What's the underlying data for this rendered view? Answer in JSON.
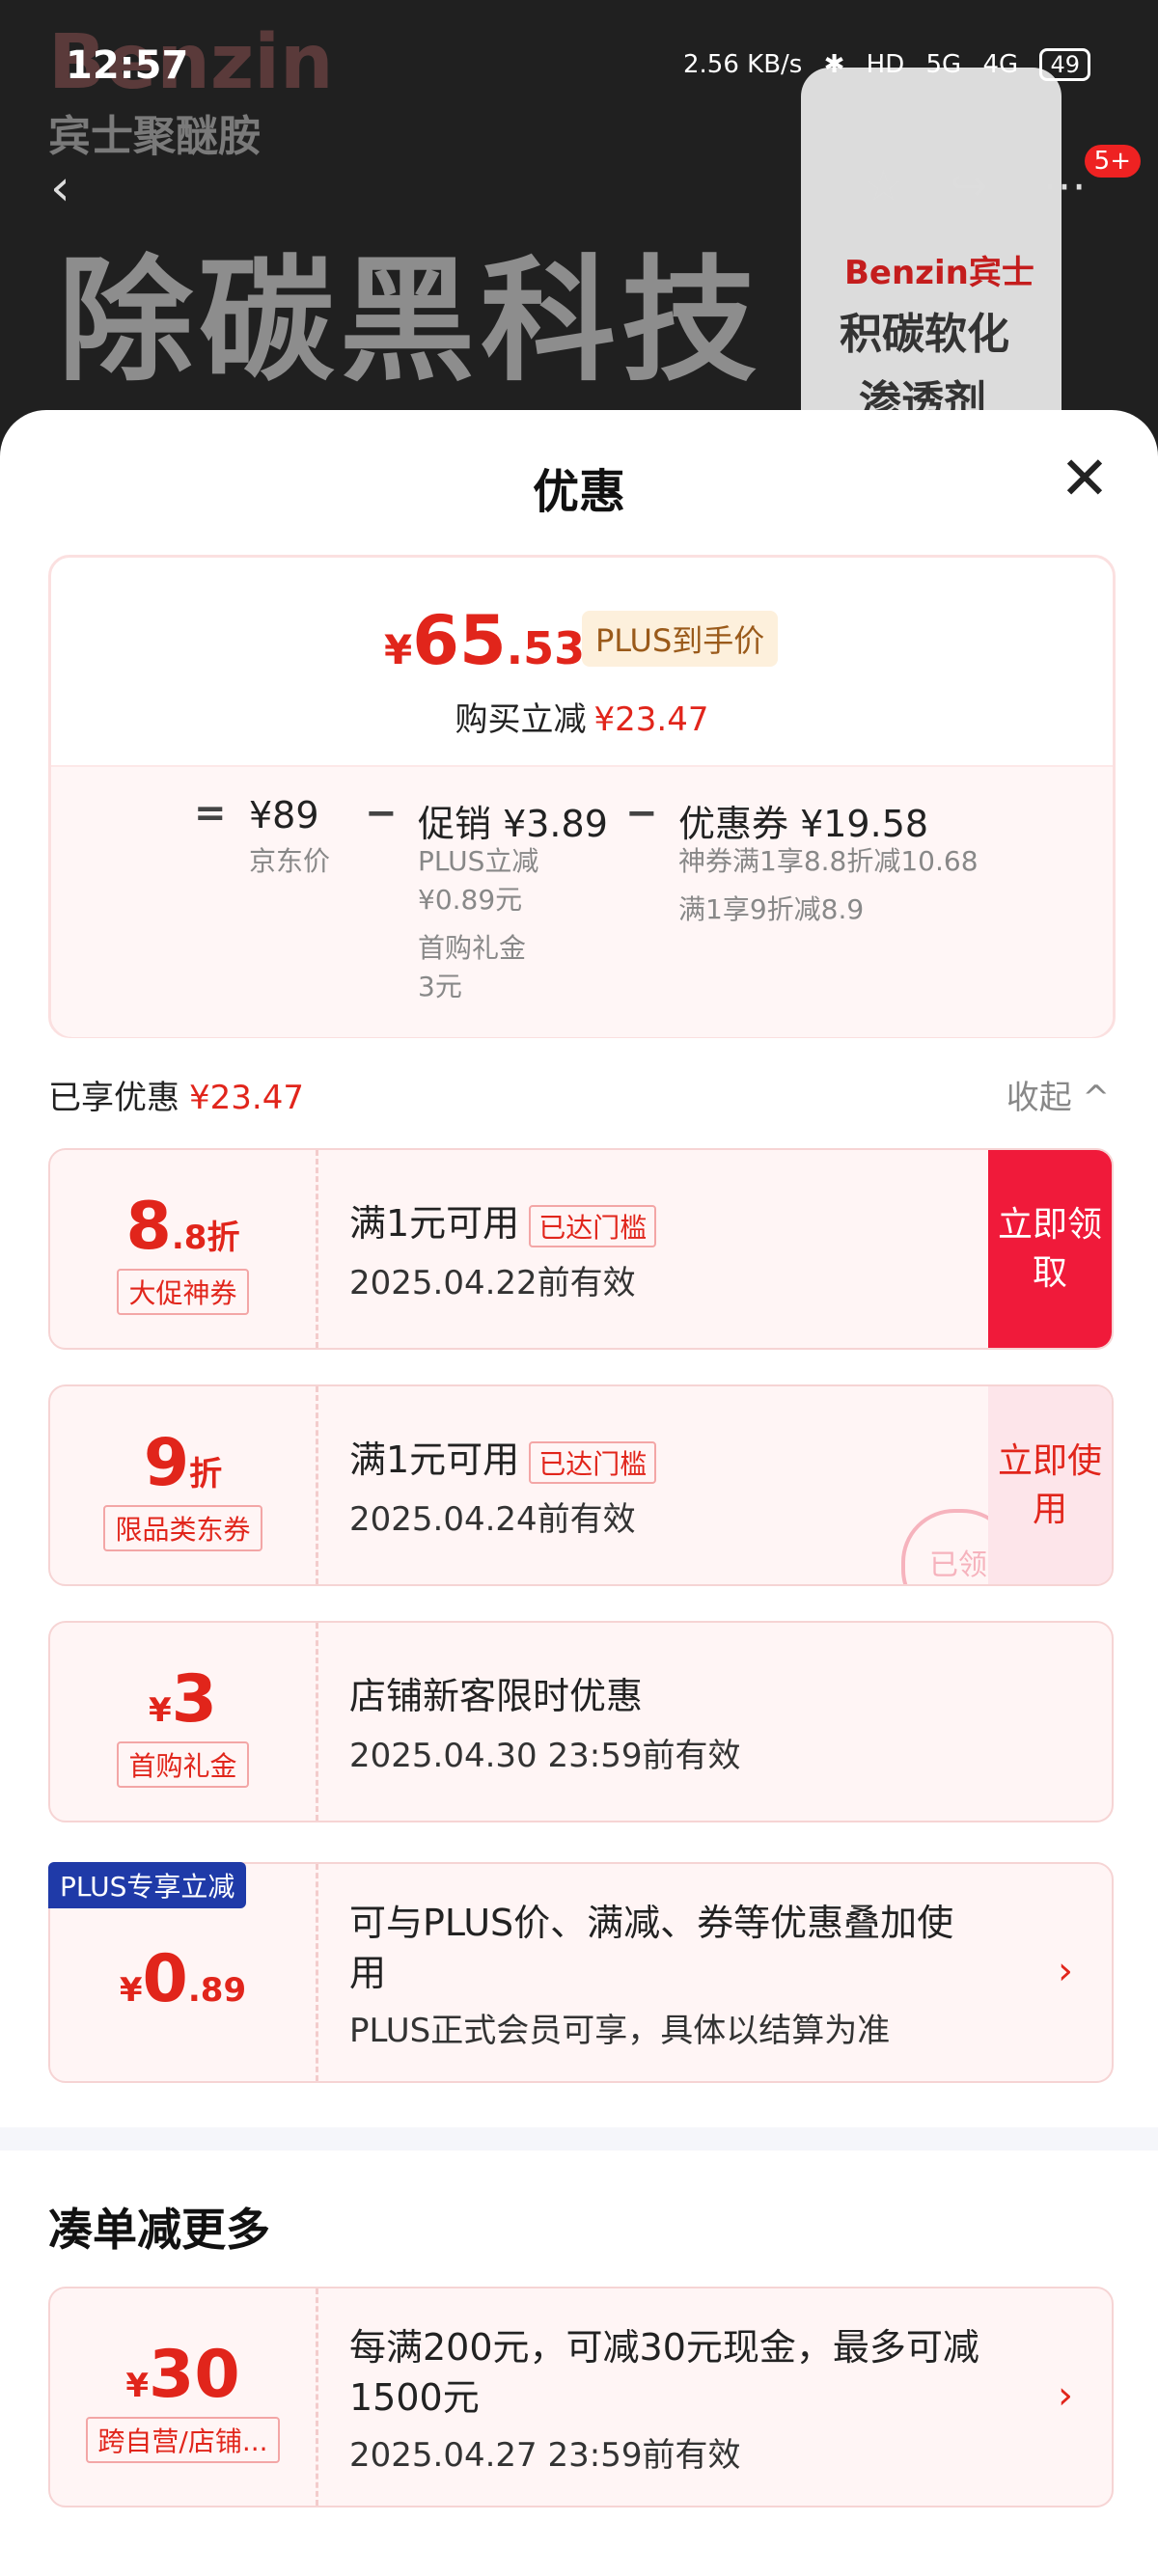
{
  "status_bar": {
    "time": "12:57",
    "speed": "2.56 KB/s",
    "hd": "HD",
    "net1": "5G",
    "net2": "4G",
    "battery": "49"
  },
  "background": {
    "brand": "Benzin",
    "brand_cn": "宾士聚醚胺",
    "headline": "除碳黑科技",
    "can_brand": "Benzin宾士",
    "can_line1": "积碳软化",
    "can_line2": "渗透剂"
  },
  "nav": {
    "back_icon": "chevron-left-icon",
    "badge": "5+"
  },
  "sheet": {
    "title": "优惠",
    "summary": {
      "price_currency": "¥",
      "price_int": "65",
      "price_dec": ".53",
      "plus_tag": "PLUS到手价",
      "reduce_label": "购买立减",
      "reduce_value": "¥23.47",
      "eq": "=",
      "jd_price": "¥89",
      "jd_label": "京东价",
      "minus1": "−",
      "promo": "促销 ¥3.89",
      "promo_sub1": "PLUS立减",
      "promo_sub1b": "¥0.89元",
      "promo_sub2": "首购礼金",
      "promo_sub2b": "3元",
      "minus2": "−",
      "coupon": "优惠券 ¥19.58",
      "coupon_sub1": "神券满1享8.8折减10.68",
      "coupon_sub2": "满1享9折减8.9"
    },
    "enjoyed_label": "已享优惠",
    "enjoyed_value": "¥23.47",
    "collapse": "收起 ^",
    "cards": [
      {
        "amt_n": "8",
        "amt_s": ".8折",
        "tag": "大促神券",
        "line1": "满1元可用",
        "reach": "已达门槛",
        "line2": "2025.04.22前有效",
        "action": "立即领取"
      },
      {
        "amt_n": "9",
        "amt_s": "折",
        "tag": "限品类东券",
        "line1": "满1元可用",
        "reach": "已达门槛",
        "line2": "2025.04.24前有效",
        "action": "立即使用",
        "stamp": "已领"
      },
      {
        "amt_y": "¥",
        "amt_n": "3",
        "tag": "首购礼金",
        "line1": "店铺新客限时优惠",
        "line2": "2025.04.30 23:59前有效"
      },
      {
        "banner": "PLUS专享立减",
        "amt_y": "¥",
        "amt_n": "0",
        "amt_s": ".89",
        "line1": "可与PLUS价、满减、券等优惠叠加使",
        "line1b": "用",
        "line2": "PLUS正式会员可享，具体以结算为准",
        "chev": "›"
      }
    ],
    "more_title": "凑单减更多",
    "more_card": {
      "amt_y": "¥",
      "amt_n": "30",
      "tag": "跨自营/店铺...",
      "line1": "每满200元，可减30元现金，最多可减",
      "line1b": "1500元",
      "line2": "2025.04.27 23:59前有效",
      "chev": "›"
    }
  }
}
